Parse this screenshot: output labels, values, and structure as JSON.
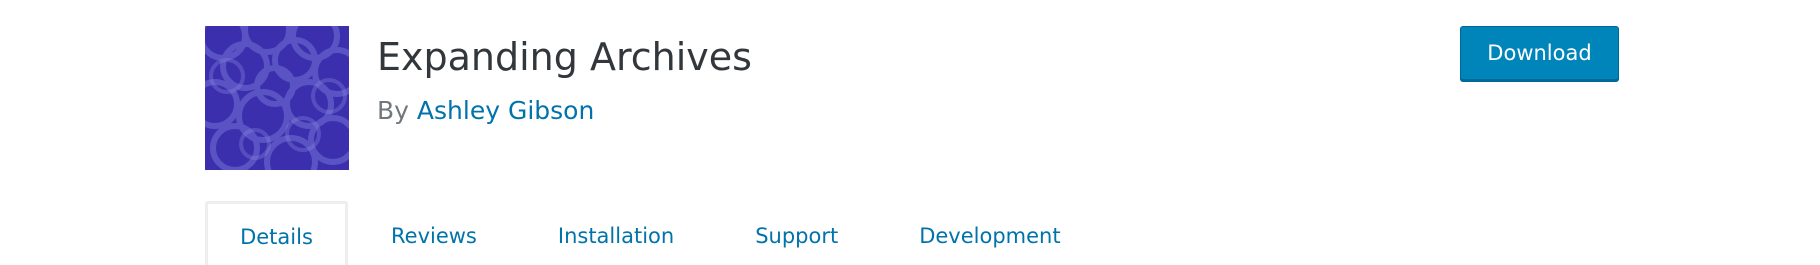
{
  "plugin": {
    "title": "Expanding Archives",
    "author_prefix": "By",
    "author_name": "Ashley Gibson",
    "icon": "circles-pattern-icon",
    "icon_colors": {
      "background": "#3b2fae",
      "circles": "#6f6ad0"
    }
  },
  "actions": {
    "download_label": "Download"
  },
  "tabs": [
    {
      "label": "Details",
      "active": true
    },
    {
      "label": "Reviews",
      "active": false
    },
    {
      "label": "Installation",
      "active": false
    },
    {
      "label": "Support",
      "active": false
    },
    {
      "label": "Development",
      "active": false
    }
  ],
  "colors": {
    "link": "#0073aa",
    "button": "#0085ba",
    "title": "#32373c",
    "muted": "#72777c",
    "tab_border": "#eeeeee"
  }
}
